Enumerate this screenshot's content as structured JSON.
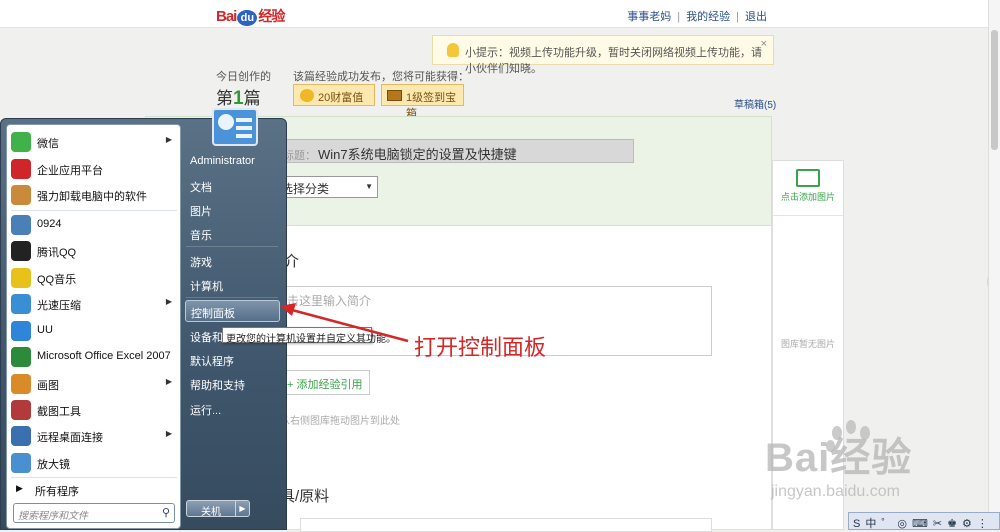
{
  "header": {
    "logo_bai": "Bai",
    "logo_du": "du",
    "logo_jingyan": "经验",
    "links": [
      "事事老妈",
      "我的经验",
      "退出"
    ]
  },
  "tip": {
    "text": "小提示：视频上传功能升级，暂时关闭网络视频上传功能，请小伙伴们知晓。",
    "close": "×"
  },
  "stats": {
    "today_label": "今日创作的",
    "count_prefix": "第",
    "count_number": "1",
    "count_suffix": "篇",
    "reward_text": "该篇经验成功发布，您将可能获得：",
    "badge_wealth": "20财富值",
    "badge_treasure": "1级签到宝箱",
    "drafts": "草稿箱(5)"
  },
  "form": {
    "title_label": "标题：",
    "title_value": "Win7系统电脑锁定的设置及快捷键",
    "category": "选择分类",
    "intro_heading": "介",
    "intro_placeholder": "击这里输入简介",
    "add_ref": "+ 添加经验引用",
    "drag_hint": "从右侧图库拖动图片到此处",
    "tools_heading": "具/原料"
  },
  "image_panel": {
    "add": "点击添加图片",
    "empty": "图库暂无图片"
  },
  "green_ball": "72",
  "start_menu": {
    "programs": [
      {
        "label": "微信",
        "icon": "wechat-icon",
        "color": "#3fb34a",
        "arrow": true
      },
      {
        "label": "企业应用平台",
        "icon": "u8-icon",
        "color": "#d0262a",
        "arrow": false
      },
      {
        "label": "强力卸载电脑中的软件",
        "icon": "uninstall-icon",
        "color": "#c98a3a",
        "arrow": false
      },
      {
        "label": "0924",
        "icon": "file-icon",
        "color": "#4b7fb8",
        "arrow": false
      },
      {
        "label": "腾讯QQ",
        "icon": "qq-icon",
        "color": "#222222",
        "arrow": false
      },
      {
        "label": "QQ音乐",
        "icon": "qq-music-icon",
        "color": "#e8c21a",
        "arrow": false
      },
      {
        "label": "光速压缩",
        "icon": "compress-icon",
        "color": "#3a8fd4",
        "arrow": true
      },
      {
        "label": "UU",
        "icon": "uu-icon",
        "color": "#2f85d8",
        "arrow": false
      },
      {
        "label": "Microsoft Office Excel 2007",
        "icon": "excel-icon",
        "color": "#2c8a3b",
        "arrow": false
      },
      {
        "label": "画图",
        "icon": "paint-icon",
        "color": "#d98b2a",
        "arrow": true
      },
      {
        "label": "截图工具",
        "icon": "scissors-icon",
        "color": "#b23a3a",
        "arrow": false
      },
      {
        "label": "远程桌面连接",
        "icon": "remote-desktop-icon",
        "color": "#3a6fb0",
        "arrow": true
      },
      {
        "label": "放大镜",
        "icon": "magnifier-icon",
        "color": "#4a8fd0",
        "arrow": false
      }
    ],
    "all_programs": "所有程序",
    "search_placeholder": "搜索程序和文件",
    "right_items": [
      "Administrator",
      "文档",
      "图片",
      "音乐",
      "游戏",
      "计算机",
      "控制面板",
      "设备和打",
      "默认程序",
      "帮助和支持",
      "运行..."
    ],
    "tooltip": "更改您的计算机设置并自定义其功能。",
    "shutdown": "关机"
  },
  "callout": "打开控制面板",
  "watermark": {
    "brand": "Bai经验",
    "url": "jingyan.baidu.com"
  },
  "tray": [
    "S",
    "中",
    "゜",
    "◎",
    "⌨",
    "✂",
    "♚",
    "⚙",
    "⋮"
  ]
}
